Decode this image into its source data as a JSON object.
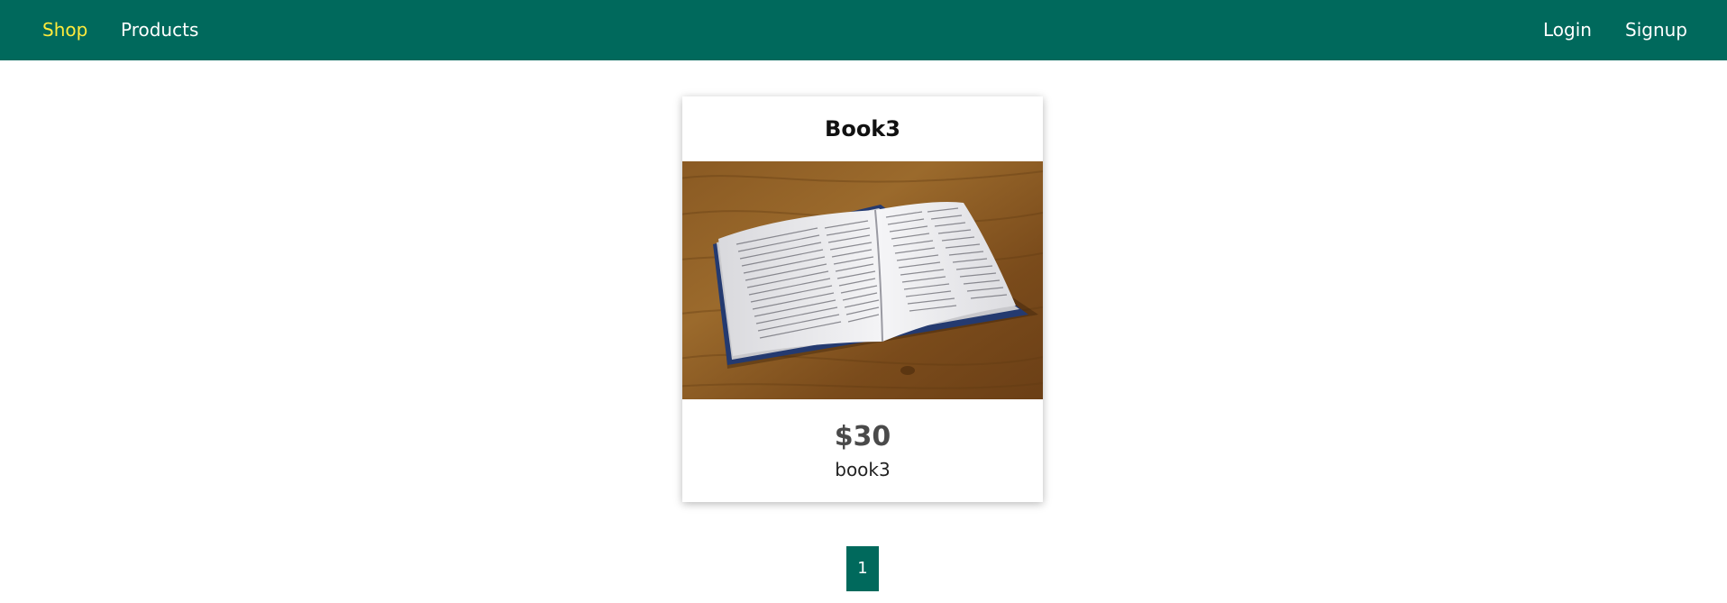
{
  "nav": {
    "left": [
      {
        "label": "Shop",
        "active": true
      },
      {
        "label": "Products",
        "active": false
      }
    ],
    "right": [
      {
        "label": "Login"
      },
      {
        "label": "Signup"
      }
    ]
  },
  "colors": {
    "header_bg": "#00695c",
    "active_link": "#ffeb3b",
    "link": "#ffffff",
    "pagination_bg": "#00695c"
  },
  "product": {
    "title": "Book3",
    "image_icon": "open-book-image",
    "price": "$30",
    "description": "book3"
  },
  "pagination": {
    "pages": [
      "1"
    ],
    "current": "1"
  }
}
